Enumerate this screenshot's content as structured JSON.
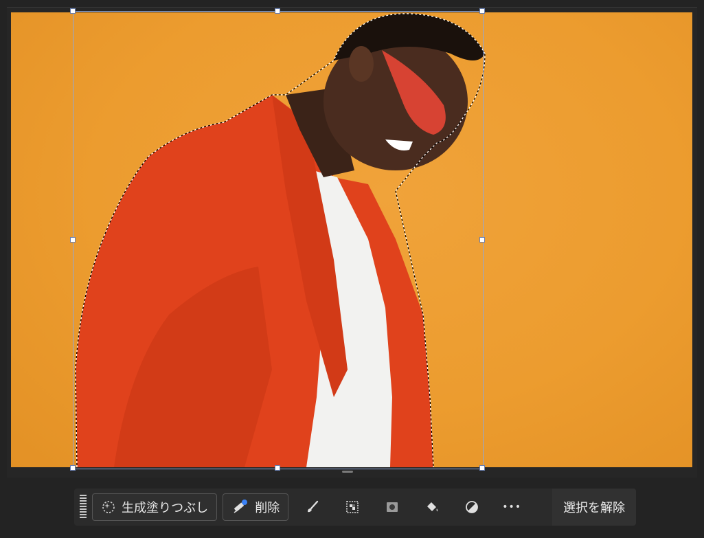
{
  "toolbar": {
    "generative_fill_label": "生成塗りつぶし",
    "remove_label": "削除",
    "deselect_label": "選択を解除",
    "more_label": "•••"
  },
  "colors": {
    "background_orange": "#ec9c2f",
    "jacket_red": "#e0421c",
    "selection_blue": "#8fa8d8",
    "badge_blue": "#3b82f6"
  },
  "icons": {
    "generative_fill": "sparkle-circle-icon",
    "remove": "magic-eraser-icon",
    "brush": "brush-icon",
    "invert_selection": "invert-selection-icon",
    "mask": "mask-icon",
    "fill": "paint-bucket-icon",
    "adjustment": "adjustment-circle-icon",
    "more": "more-icon"
  }
}
